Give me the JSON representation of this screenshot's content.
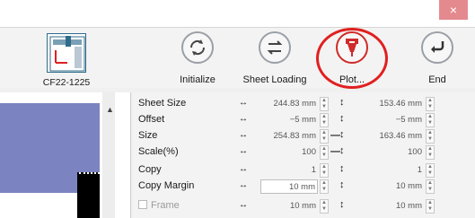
{
  "window": {
    "close_glyph": "×"
  },
  "machine": {
    "label": "CF22-1225"
  },
  "toolbar": {
    "initialize_label": "Initialize",
    "sheet_loading_label": "Sheet Loading",
    "plot_label": "Plot...",
    "end_label": "End"
  },
  "rows": [
    {
      "label": "Sheet Size",
      "h_arrow": "↔",
      "v1": "244.83 mm",
      "v_arrow": "↕",
      "v2": "153.46 mm"
    },
    {
      "label": "Offset",
      "h_arrow": "↔",
      "v1": "−5 mm",
      "v_arrow": "↕",
      "v2": "−5 mm"
    },
    {
      "label": "Size",
      "h_arrow": "↔",
      "v1": "254.83 mm",
      "v_arrow": "↕",
      "v2": "163.46 mm"
    },
    {
      "label": "Scale(%)",
      "h_arrow": "↔",
      "v1": "100",
      "v_arrow": "↕",
      "v2": "100"
    },
    {
      "label": "Copy",
      "h_arrow": "↔",
      "v1": "1",
      "v_arrow": "↕",
      "v2": "1"
    },
    {
      "label": "Copy Margin",
      "h_arrow": "↔",
      "v1": "10 mm",
      "v_arrow": "↕",
      "v2": "10 mm"
    },
    {
      "label": "Frame",
      "h_arrow": "↔",
      "v1": "10 mm",
      "v_arrow": "↕",
      "v2": "10 mm"
    }
  ],
  "colors": {
    "accent": "#e02020",
    "preview_blue": "#7b83c0"
  }
}
